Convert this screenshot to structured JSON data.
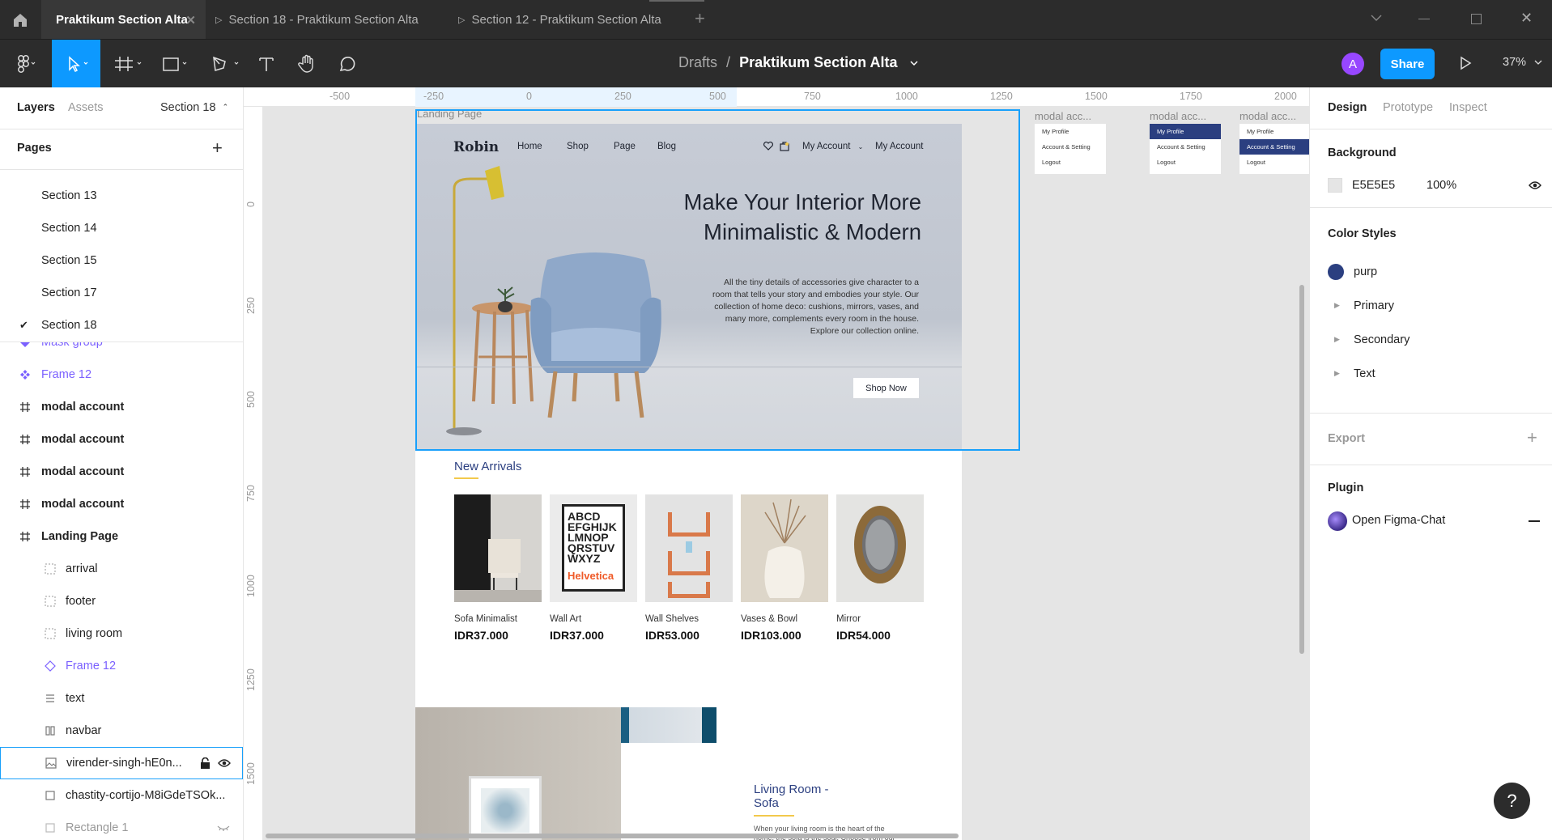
{
  "window": {
    "tabs": [
      {
        "label": "Praktikum Section Alta"
      },
      {
        "label": "Section 18 - Praktikum Section Alta"
      },
      {
        "label": "Section 12 - Praktikum Section Alta"
      }
    ]
  },
  "toolbar": {
    "breadcrumb_root": "Drafts",
    "breadcrumb_sep": "/",
    "file_name": "Praktikum Section Alta",
    "avatar_letter": "A",
    "share_label": "Share",
    "zoom": "37%"
  },
  "left_panel": {
    "tab_layers": "Layers",
    "tab_assets": "Assets",
    "current_page": "Section 18",
    "pages_heading": "Pages",
    "pages": [
      {
        "label": "Section 13"
      },
      {
        "label": "Section 14"
      },
      {
        "label": "Section 15"
      },
      {
        "label": "Section 17"
      },
      {
        "label": "Section 18"
      }
    ],
    "layers": [
      {
        "label": "Mask group"
      },
      {
        "label": "Frame 12"
      },
      {
        "label": "modal account"
      },
      {
        "label": "modal account"
      },
      {
        "label": "modal account"
      },
      {
        "label": "modal account"
      },
      {
        "label": "Landing Page"
      },
      {
        "label": "arrival"
      },
      {
        "label": "footer"
      },
      {
        "label": "living room"
      },
      {
        "label": "Frame 12"
      },
      {
        "label": "text"
      },
      {
        "label": "navbar"
      },
      {
        "label": "virender-singh-hE0n..."
      },
      {
        "label": "chastity-cortijo-M8iGdeTSOk..."
      },
      {
        "label": "Rectangle 1"
      }
    ]
  },
  "rulers": {
    "top": [
      "-500",
      "-250",
      "0",
      "250",
      "500",
      "750",
      "1000",
      "1250",
      "1500",
      "1750",
      "2000"
    ],
    "left": [
      "0",
      "250",
      "500",
      "750",
      "1000",
      "1250",
      "1500"
    ]
  },
  "canvas": {
    "frame_label": "Landing Page",
    "modal_labels": [
      "modal acc...",
      "modal acc...",
      "modal acc..."
    ],
    "modal_items": [
      "My Profile",
      "Account & Setting",
      "Logout"
    ],
    "site": {
      "logo": "Robin",
      "nav": [
        "Home",
        "Shop",
        "Page",
        "Blog"
      ],
      "account_dropdown": "My Account",
      "account_link": "My Account",
      "hero_title_1": "Make Your Interior More",
      "hero_title_2": "Minimalistic & Modern",
      "hero_body_1": "All the tiny details of accessories give character to a",
      "hero_body_2": "room that tells your story and embodies your style. Our",
      "hero_body_3": "collection of home deco: cushions, mirrors, vases, and",
      "hero_body_4": "many more, complements every room in the house.",
      "hero_body_5": "Explore our collection online.",
      "cta": "Shop Now",
      "new_arrivals": "New Arrivals",
      "products": [
        {
          "name": "Sofa Minimalist",
          "price": "IDR37.000"
        },
        {
          "name": "Wall Art",
          "price": "IDR37.000"
        },
        {
          "name": "Wall Shelves",
          "price": "IDR53.000"
        },
        {
          "name": "Vases & Bowl",
          "price": "IDR103.000"
        },
        {
          "name": "Mirror",
          "price": "IDR54.000"
        }
      ],
      "wall_art_text": [
        "ABCD",
        "EFGHIJK",
        "LMNOP",
        "QRSTUV",
        "WXYZ",
        "Helvetica"
      ],
      "living_title_1": "Living Room -",
      "living_title_2": "Sofa",
      "living_body_1": "When your living room is the heart of the",
      "living_body_2": "home, the sofa is the soul. Choose from our"
    }
  },
  "right_panel": {
    "tabs": [
      "Design",
      "Prototype",
      "Inspect"
    ],
    "background_heading": "Background",
    "background_hex": "E5E5E5",
    "background_opacity": "100%",
    "color_styles_heading": "Color Styles",
    "color_styles": [
      {
        "label": "purp",
        "color": "#2b3f80"
      },
      {
        "label": "Primary"
      },
      {
        "label": "Secondary"
      },
      {
        "label": "Text"
      }
    ],
    "export_heading": "Export",
    "plugin_heading": "Plugin",
    "plugin_name": "Open Figma-Chat"
  },
  "help_label": "?",
  "colors": {
    "accent": "#0d99ff",
    "selection": "#18a0fb",
    "component": "#7b61ff",
    "navy": "#2b3f80",
    "underline": "#f2c94c",
    "chrome": "#2c2c2c"
  }
}
